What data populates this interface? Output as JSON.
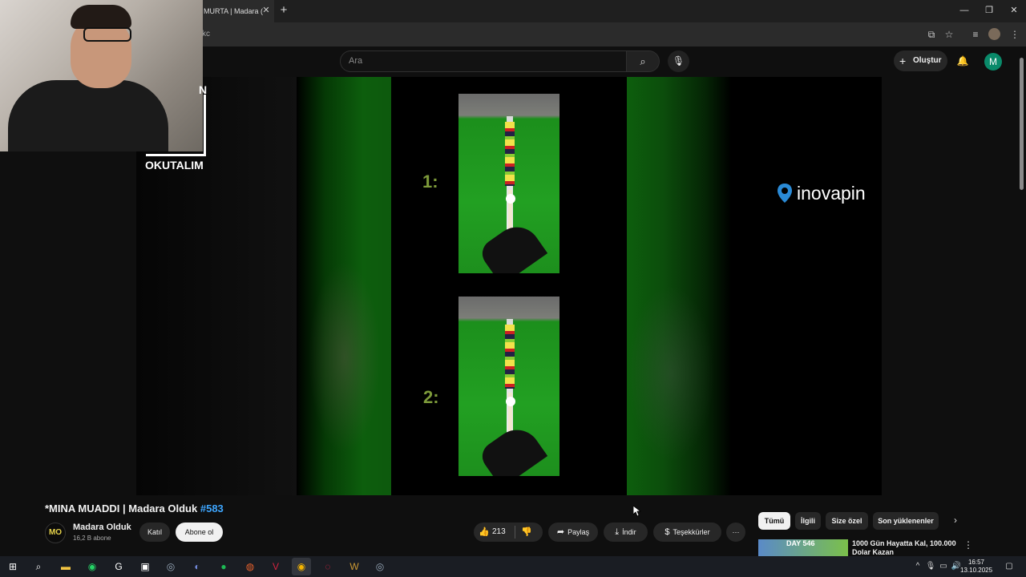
{
  "browser": {
    "tab_title": "MURTA | Madara (",
    "tab_close": "✕",
    "new_tab": "+",
    "url": "kc",
    "window_controls": {
      "minimize": "—",
      "restore": "❐",
      "close": "✕"
    }
  },
  "youtube": {
    "search_placeholder": "Ara",
    "create_label": "Oluştur",
    "account_initial": "M"
  },
  "video": {
    "label_1": "1:",
    "label_2": "2:",
    "sponsor_logo": "inovapin",
    "webcam_overlay_text": "OKUTALIM",
    "webcam_overlay_letter": "N",
    "title": "*MINA MUADDI | Madara Olduk",
    "title_hashtag": "#583"
  },
  "channel": {
    "name": "Madara Olduk",
    "subscribers": "16,2 B abone",
    "join_label": "Katıl",
    "subscribe_label": "Abone ol"
  },
  "actions": {
    "like_count": "213",
    "share_label": "Paylaş",
    "download_label": "İndir",
    "thanks_label": "Teşekkürler",
    "more_label": "···"
  },
  "chips": [
    "Tümü",
    "İlgili",
    "Size özel",
    "Son yüklenenler"
  ],
  "recommendation": {
    "thumb_text": "DAY 546",
    "title": "1000 Gün Hayatta Kal, 100.000 Dolar Kazan"
  },
  "taskbar": {
    "time": "16:57",
    "date": "13.10.2025"
  },
  "colors": {
    "accent_link": "#3ea6ff",
    "account": "#0a8a6a",
    "felt_green": "#22a022"
  }
}
